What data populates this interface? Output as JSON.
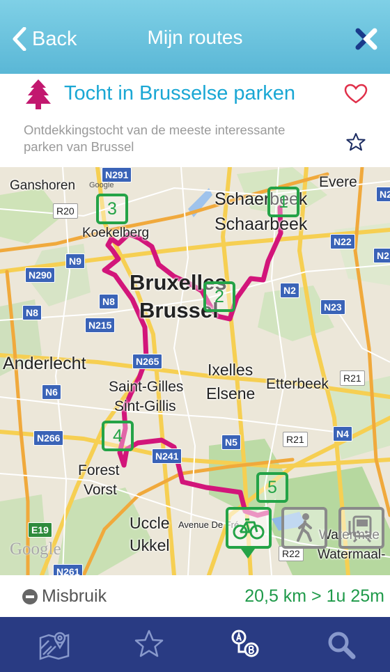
{
  "navbar": {
    "back_label": "Back",
    "title": "Mijn routes",
    "close_icon": "x-close-icon"
  },
  "route": {
    "title": "Tocht in Brusselse parken",
    "description": "Ontdekkingstocht van de meeste interessante parken van Brussel",
    "category_icon": "tree-icon",
    "favorite_icon": "heart-icon",
    "star_icon": "star-icon",
    "colors": {
      "title": "#1aa7d4",
      "tree": "#c2186f",
      "heart": "#e0304a"
    }
  },
  "map": {
    "places": {
      "ganshoren": "Ganshoren",
      "schaerbeek": "Schaerbeek",
      "schaarbeek": "Schaarbeek",
      "evere": "Evere",
      "koekelberg": "Koekelberg",
      "bruxelles": "Bruxelles",
      "brussel": "Brussel",
      "anderlecht": "Anderlecht",
      "ixelles": "Ixelles",
      "elsene": "Elsene",
      "etterbeek": "Etterbeek",
      "saint_gilles": "Saint-Gilles",
      "sint_gillis": "Sint-Gillis",
      "forest": "Forest",
      "vorst": "Vorst",
      "uccle": "Uccle",
      "ukkel": "Ukkel",
      "avenue": "Avenue De Fré",
      "watermael": "Watermae",
      "watermaal": "Watermaal-"
    },
    "roads": {
      "n291": "N291",
      "r20": "R20",
      "n2_top": "N2",
      "n22": "N22",
      "n2_right": "N2",
      "n9": "N9",
      "n290": "N290",
      "n2_mid": "N2",
      "n8_left": "N8",
      "n8": "N8",
      "n23": "N23",
      "n215": "N215",
      "n265": "N265",
      "r21_right": "R21",
      "n6": "N6",
      "n266": "N266",
      "n5": "N5",
      "r21": "R21",
      "n4": "N4",
      "n241": "N241",
      "e19": "E19",
      "r22": "R22",
      "n261": "N261"
    },
    "markers": [
      "1",
      "2",
      "3",
      "4",
      "5"
    ],
    "google_small": "Google",
    "google_logo": "Google",
    "route_color": "#d2157a",
    "marker_color": "#24a347",
    "bike_icon": "bicycle-icon",
    "walk_icon": "walking-person-icon",
    "transit_icon": "train-icon"
  },
  "stats": {
    "report_label": "Misbruik",
    "distance_time": "20,5 km > 1u 25m"
  },
  "tabbar": {
    "items": [
      {
        "icon": "map-icon"
      },
      {
        "icon": "star-icon"
      },
      {
        "icon": "route-ab-icon"
      },
      {
        "icon": "search-icon"
      }
    ],
    "colors": {
      "background": "#293b83",
      "icon": "#8899cc",
      "active_icon": "#ffffff"
    }
  }
}
